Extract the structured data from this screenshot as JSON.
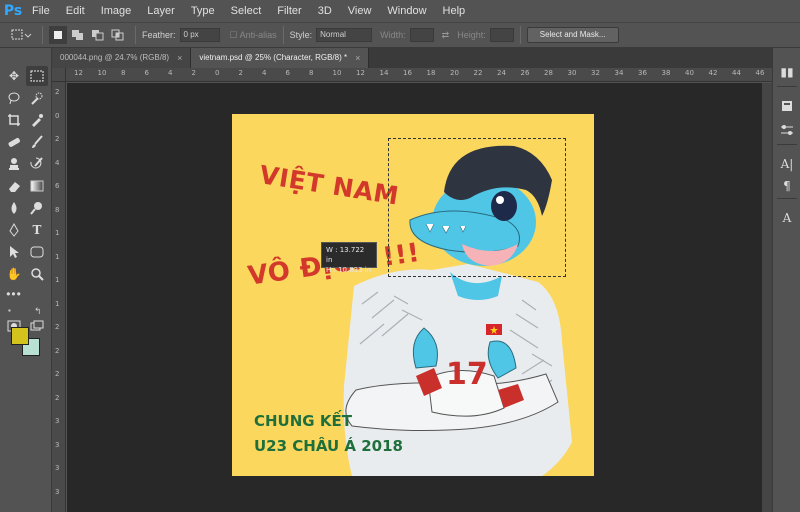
{
  "app": {
    "logo": "Ps"
  },
  "menu": [
    "File",
    "Edit",
    "Image",
    "Layer",
    "Type",
    "Select",
    "Filter",
    "3D",
    "View",
    "Window",
    "Help"
  ],
  "options": {
    "feather_label": "Feather:",
    "feather_value": "0 px",
    "antialias_label": "Anti-alias",
    "style_label": "Style:",
    "style_value": "Normal",
    "width_label": "Width:",
    "height_label": "Height:",
    "select_mask": "Select and Mask..."
  },
  "tabs": [
    {
      "label": "000044.png @ 24.7% (RGB/8)",
      "active": false
    },
    {
      "label": "vietnam.psd @ 25% (Character, RGB/8) *",
      "active": true
    }
  ],
  "canvas": {
    "headline_1": "VIỆT NAM",
    "headline_2": "VÔ ĐỊCH !!!",
    "sub_1": "CHUNG KẾT",
    "sub_2": "U23 CHÂU Á 2018",
    "jersey_number": "17"
  },
  "tooltip": {
    "w": "W :   13.722 in",
    "h": "H :   10.833 in"
  },
  "ruler_top": [
    "12",
    "10",
    "8",
    "6",
    "4",
    "2",
    "0",
    "2",
    "4",
    "6",
    "8",
    "10",
    "12",
    "14",
    "16",
    "18",
    "20",
    "22",
    "24",
    "26",
    "28",
    "30",
    "32",
    "34",
    "36",
    "38",
    "40",
    "42",
    "44",
    "46"
  ],
  "ruler_left": [
    "2",
    "0",
    "2",
    "4",
    "6",
    "8",
    "1",
    "1",
    "1",
    "1",
    "2",
    "2",
    "2",
    "2",
    "3",
    "3",
    "3",
    "3"
  ],
  "colors": {
    "foreground": "#d4c31c",
    "background": "#b8e0d3",
    "canvas_bg": "#fbd75e",
    "headline": "#d3392b",
    "sub": "#1f6f3d"
  },
  "dock_icons": [
    "collapse-icon",
    "layers-icon",
    "adjustments-icon",
    "character-icon",
    "paragraph-icon",
    "glyphs-icon"
  ]
}
